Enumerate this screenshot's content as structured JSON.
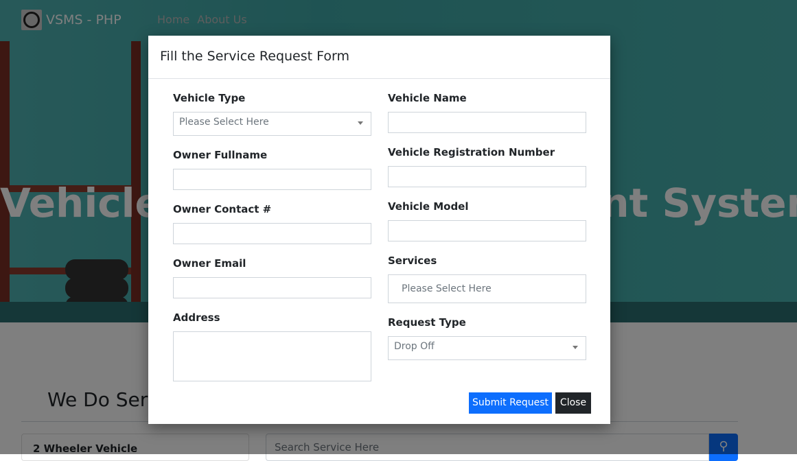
{
  "navbar": {
    "brand": "VSMS - PHP",
    "links": [
      "Home",
      "About Us"
    ]
  },
  "hero": {
    "title": "Vehicle Service Management System"
  },
  "services_section": {
    "heading": "We Do Services",
    "category": "2 Wheeler Vehicle",
    "search_placeholder": "Search Service Here"
  },
  "modal": {
    "title": "Fill the Service Request Form",
    "fields": {
      "vehicle_type": {
        "label": "Vehicle Type",
        "placeholder": "Please Select Here"
      },
      "owner_fullname": {
        "label": "Owner Fullname",
        "value": ""
      },
      "owner_contact": {
        "label": "Owner Contact #",
        "value": ""
      },
      "owner_email": {
        "label": "Owner Email",
        "value": ""
      },
      "address": {
        "label": "Address",
        "value": ""
      },
      "vehicle_name": {
        "label": "Vehicle Name",
        "value": ""
      },
      "vehicle_registration_number": {
        "label": "Vehicle Registration Number",
        "value": ""
      },
      "vehicle_model": {
        "label": "Vehicle Model",
        "value": ""
      },
      "services": {
        "label": "Services",
        "placeholder": "Please Select Here"
      },
      "request_type": {
        "label": "Request Type",
        "value": "Drop Off"
      }
    },
    "submit_label": "Submit Request",
    "close_label": "Close"
  },
  "colors": {
    "primary": "#0d6efd",
    "dark": "#212529",
    "hero": "#3fa7a6"
  }
}
